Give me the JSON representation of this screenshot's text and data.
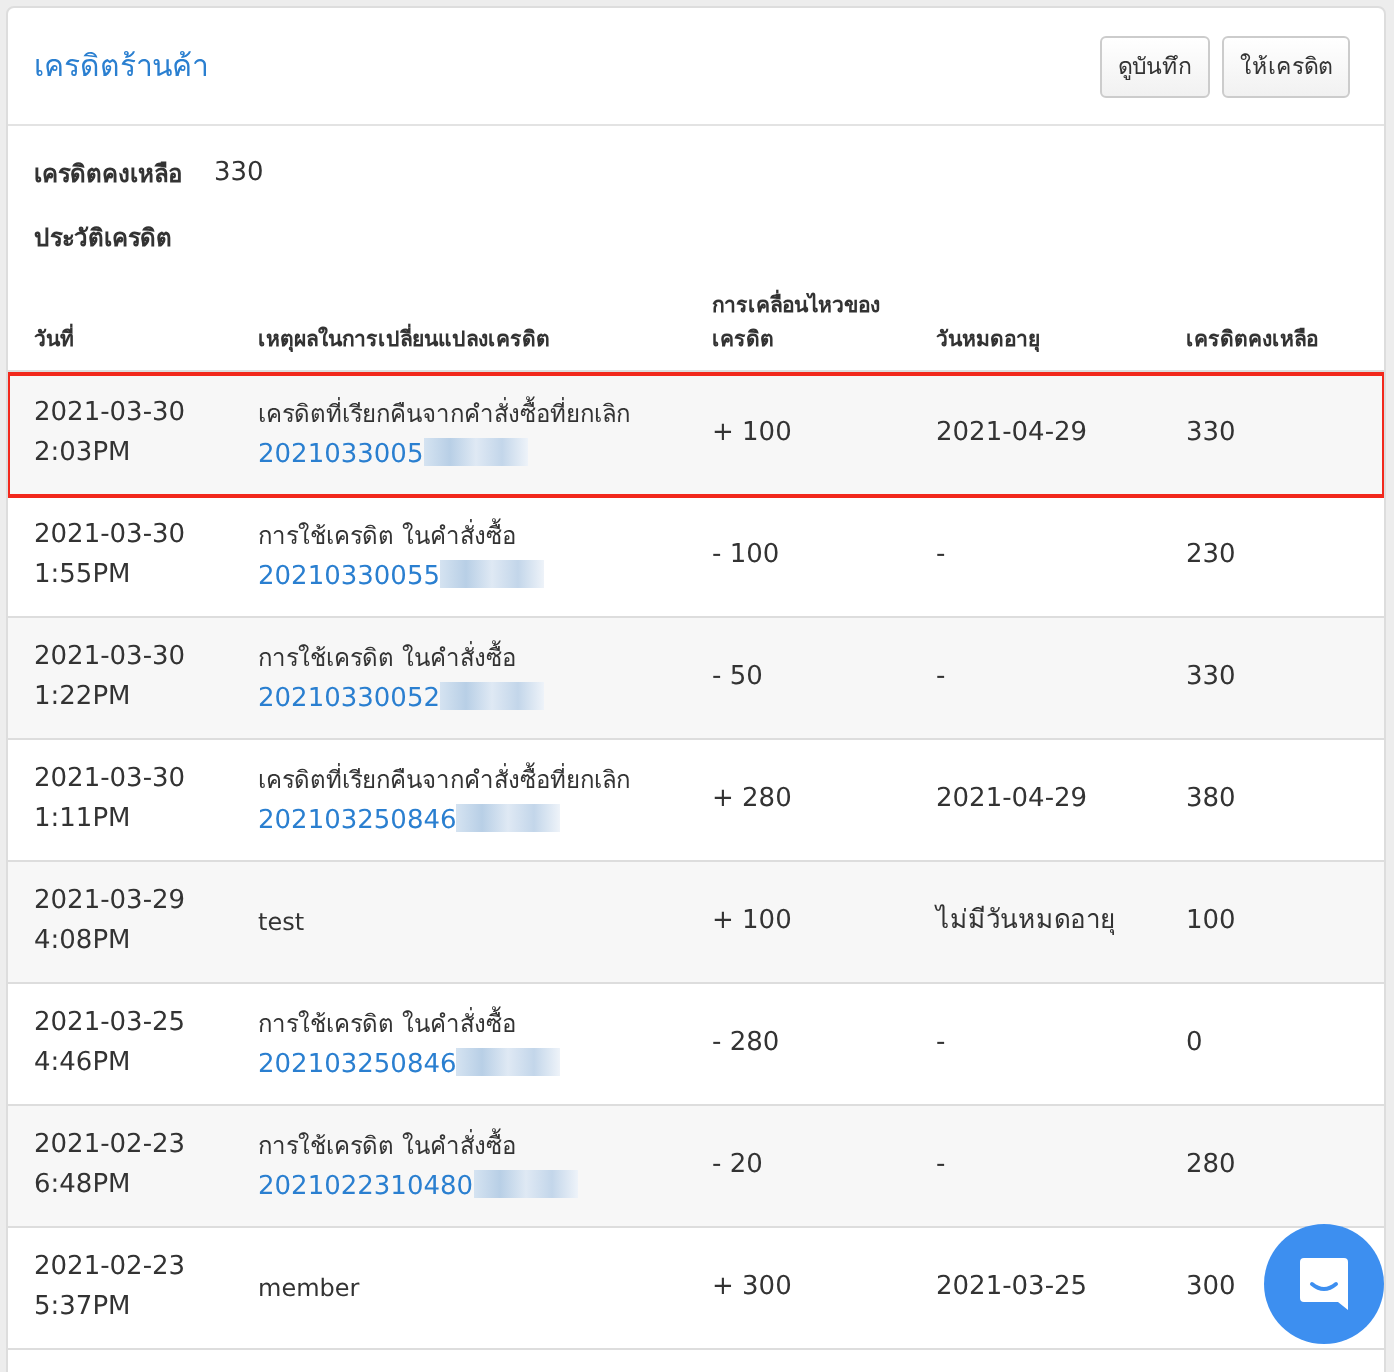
{
  "header": {
    "title": "เครดิตร้านค้า",
    "buttons": [
      "ดูบันทึก",
      "ให้เครดิต"
    ]
  },
  "balance": {
    "label": "เครดิตคงเหลือ",
    "value": "330"
  },
  "history_title": "ประวัติเครดิต",
  "table": {
    "columns": [
      "วันที่",
      "เหตุผลในการเปลี่ยนแปลงเครดิต",
      "การเคลื่อนไหวของเครดิต",
      "วันหมดอายุ",
      "เครดิตคงเหลือ"
    ],
    "rows": [
      {
        "date": "2021-03-30",
        "time": "2:03PM",
        "reason": "เครดิตที่เรียกคืนจากคำสั่งซื้อที่ยกเลิก",
        "order": "2021033005",
        "redacted": true,
        "change": "+ 100",
        "expiry": "2021-04-29",
        "balance": "330",
        "highlighted": true
      },
      {
        "date": "2021-03-30",
        "time": "1:55PM",
        "reason": "การใช้เครดิต ในคำสั่งซื้อ",
        "order": "20210330055",
        "redacted": true,
        "change": "- 100",
        "expiry": "-",
        "balance": "230",
        "highlighted": false
      },
      {
        "date": "2021-03-30",
        "time": "1:22PM",
        "reason": "การใช้เครดิต ในคำสั่งซื้อ",
        "order": "20210330052",
        "redacted": true,
        "change": "- 50",
        "expiry": "-",
        "balance": "330",
        "highlighted": false
      },
      {
        "date": "2021-03-30",
        "time": "1:11PM",
        "reason": "เครดิตที่เรียกคืนจากคำสั่งซื้อที่ยกเลิก",
        "order": "202103250846",
        "redacted": true,
        "change": "+ 280",
        "expiry": "2021-04-29",
        "balance": "380",
        "highlighted": false
      },
      {
        "date": "2021-03-29",
        "time": "4:08PM",
        "reason": "test",
        "change": "+ 100",
        "expiry": "ไม่มีวันหมดอายุ",
        "balance": "100",
        "highlighted": false
      },
      {
        "date": "2021-03-25",
        "time": "4:46PM",
        "reason": "การใช้เครดิต ในคำสั่งซื้อ",
        "order": "202103250846",
        "redacted": true,
        "change": "- 280",
        "expiry": "-",
        "balance": "0",
        "highlighted": false
      },
      {
        "date": "2021-02-23",
        "time": "6:48PM",
        "reason": "การใช้เครดิต ในคำสั่งซื้อ",
        "order": "2021022310480",
        "redacted": true,
        "change": "- 20",
        "expiry": "-",
        "balance": "280",
        "highlighted": false
      },
      {
        "date": "2021-02-23",
        "time": "5:37PM",
        "reason": "member",
        "change": "+ 300",
        "expiry": "2021-03-25",
        "balance": "300",
        "highlighted": false
      }
    ]
  }
}
